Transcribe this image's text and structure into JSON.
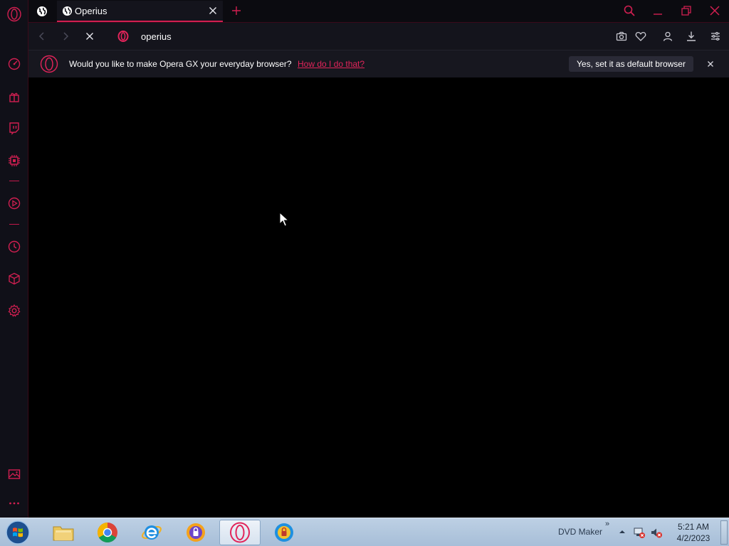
{
  "colors": {
    "accent": "#e2245a",
    "sidebar_bg": "#101018",
    "tabstrip_bg": "#0b0b10",
    "toolbar_bg": "#14141c",
    "content_bg": "#000000",
    "taskbar": "#b3c7dd"
  },
  "sidebar": {
    "items": [
      {
        "name": "opera-gx-menu",
        "icon": "opera-o-icon"
      },
      {
        "name": "gx-control",
        "icon": "speedometer-icon"
      },
      {
        "name": "gx-corner",
        "icon": "gift-icon"
      },
      {
        "name": "twitch",
        "icon": "twitch-icon"
      },
      {
        "name": "cpu-limiter",
        "icon": "chip-icon"
      },
      {
        "name": "player",
        "icon": "play-icon"
      },
      {
        "name": "history",
        "icon": "clock-icon"
      },
      {
        "name": "extensions",
        "icon": "cube-icon"
      },
      {
        "name": "settings",
        "icon": "gear-icon"
      },
      {
        "name": "wallpaper",
        "icon": "image-icon"
      },
      {
        "name": "more",
        "icon": "ellipsis-icon"
      }
    ]
  },
  "tabs": {
    "active_title": "Operius",
    "new_tab_label": "+"
  },
  "addressbar": {
    "url": "operius"
  },
  "notification": {
    "message": "Would you like to make Opera GX your everyday browser?",
    "link": "How do I do that?",
    "button": "Yes, set it as default browser"
  },
  "taskbar": {
    "apps": [
      {
        "name": "explorer",
        "icon": "folder-icon"
      },
      {
        "name": "chrome",
        "icon": "chrome-icon"
      },
      {
        "name": "internet-explorer",
        "icon": "ie-icon"
      },
      {
        "name": "app-lock-1",
        "icon": "lock-app-icon"
      },
      {
        "name": "opera-gx",
        "icon": "opera-o-icon",
        "active": true
      },
      {
        "name": "app-lock-2",
        "icon": "lock-app-icon"
      }
    ],
    "toolbar_label": "DVD Maker",
    "chevron": "»",
    "time": "5:21 AM",
    "date": "4/2/2023"
  }
}
